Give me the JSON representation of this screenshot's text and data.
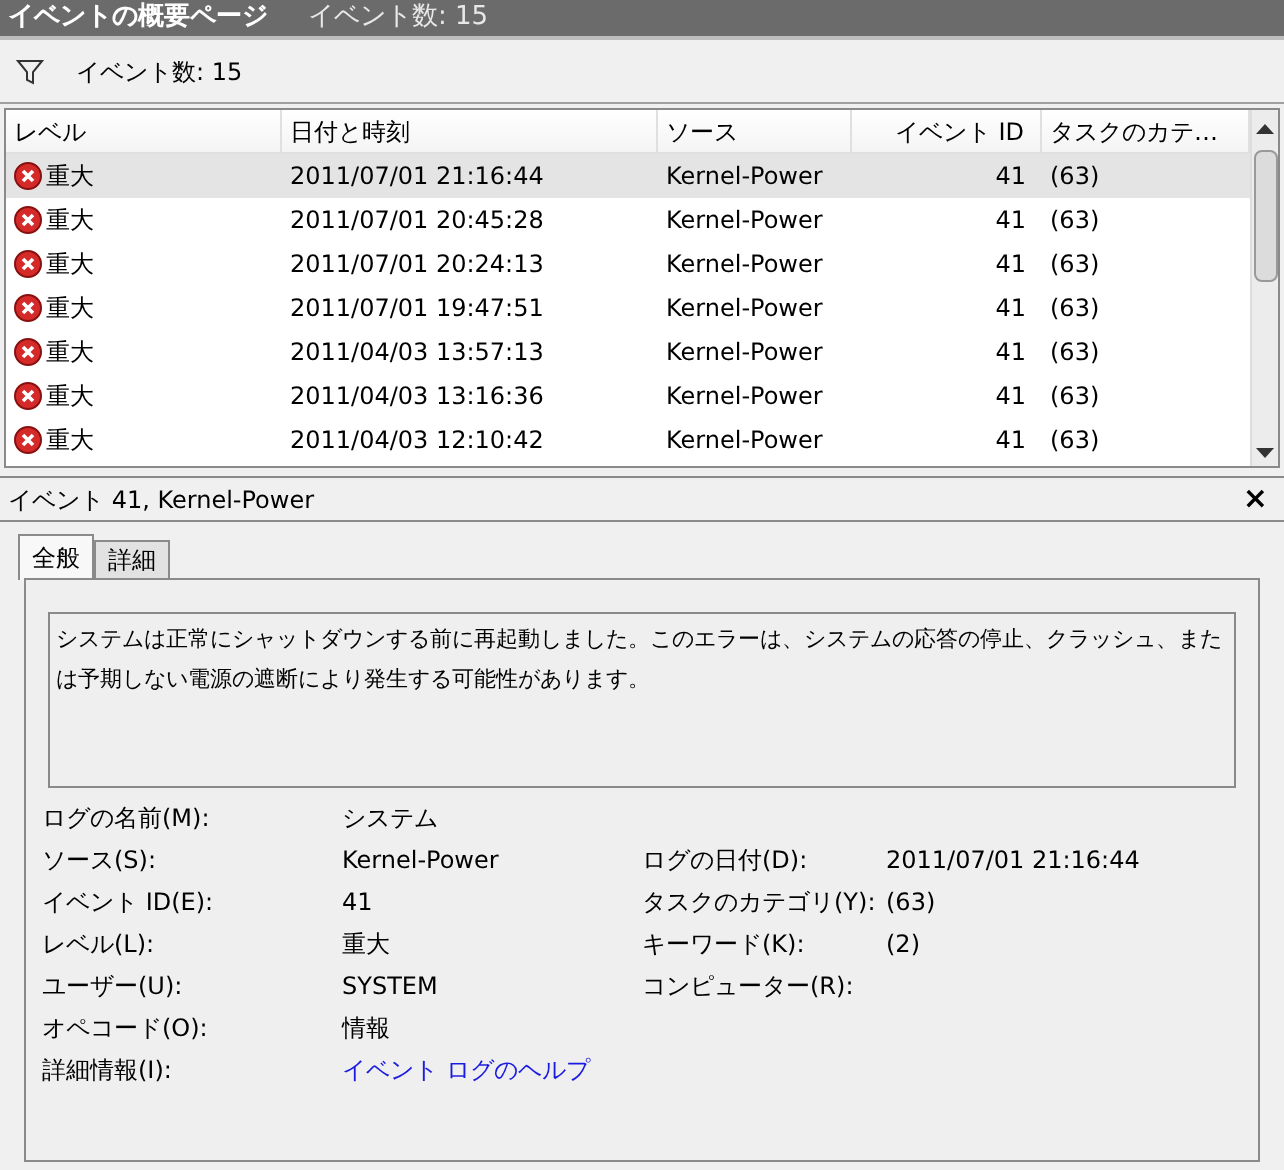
{
  "header": {
    "title": "イベントの概要ページ",
    "count": "イベント数: 15"
  },
  "filter_bar": {
    "count": "イベント数: 15"
  },
  "table": {
    "columns": [
      "レベル",
      "日付と時刻",
      "ソース",
      "イベント ID",
      "タスクのカテ…"
    ],
    "rows": [
      {
        "selected": true,
        "level": "重大",
        "date": "2011/07/01 21:16:44",
        "source": "Kernel-Power",
        "event_id": "41",
        "task": "(63)"
      },
      {
        "selected": false,
        "level": "重大",
        "date": "2011/07/01 20:45:28",
        "source": "Kernel-Power",
        "event_id": "41",
        "task": "(63)"
      },
      {
        "selected": false,
        "level": "重大",
        "date": "2011/07/01 20:24:13",
        "source": "Kernel-Power",
        "event_id": "41",
        "task": "(63)"
      },
      {
        "selected": false,
        "level": "重大",
        "date": "2011/07/01 19:47:51",
        "source": "Kernel-Power",
        "event_id": "41",
        "task": "(63)"
      },
      {
        "selected": false,
        "level": "重大",
        "date": "2011/04/03 13:57:13",
        "source": "Kernel-Power",
        "event_id": "41",
        "task": "(63)"
      },
      {
        "selected": false,
        "level": "重大",
        "date": "2011/04/03 13:16:36",
        "source": "Kernel-Power",
        "event_id": "41",
        "task": "(63)"
      },
      {
        "selected": false,
        "level": "重大",
        "date": "2011/04/03 12:10:42",
        "source": "Kernel-Power",
        "event_id": "41",
        "task": "(63)"
      }
    ]
  },
  "detail": {
    "title": "イベント 41, Kernel-Power",
    "close": "×",
    "tabs": [
      {
        "label": "全般",
        "selected": true
      },
      {
        "label": "詳細",
        "selected": false
      }
    ],
    "description": "システムは正常にシャットダウンする前に再起動しました。このエラーは、システムの応答の停止、クラッシュ、または予期しない電源の遮断により発生する可能性があります。",
    "fields": [
      [
        {
          "label": "ログの名前(M):",
          "value": "システム"
        }
      ],
      [
        {
          "label": "ソース(S):",
          "value": "Kernel-Power"
        },
        {
          "label": "ログの日付(D):",
          "value": "2011/07/01 21:16:44"
        }
      ],
      [
        {
          "label": "イベント ID(E):",
          "value": "41"
        },
        {
          "label": "タスクのカテゴリ(Y):",
          "value": "(63)"
        }
      ],
      [
        {
          "label": "レベル(L):",
          "value": "重大"
        },
        {
          "label": "キーワード(K):",
          "value": "(2)"
        }
      ],
      [
        {
          "label": "ユーザー(U):",
          "value": "SYSTEM"
        },
        {
          "label": "コンピューター(R):"
        }
      ],
      [
        {
          "label": "オペコード(O):",
          "value": "情報"
        }
      ],
      [
        {
          "label": "詳細情報(I):",
          "value": "イベント ログのヘルプ",
          "kind": "link"
        }
      ]
    ]
  }
}
